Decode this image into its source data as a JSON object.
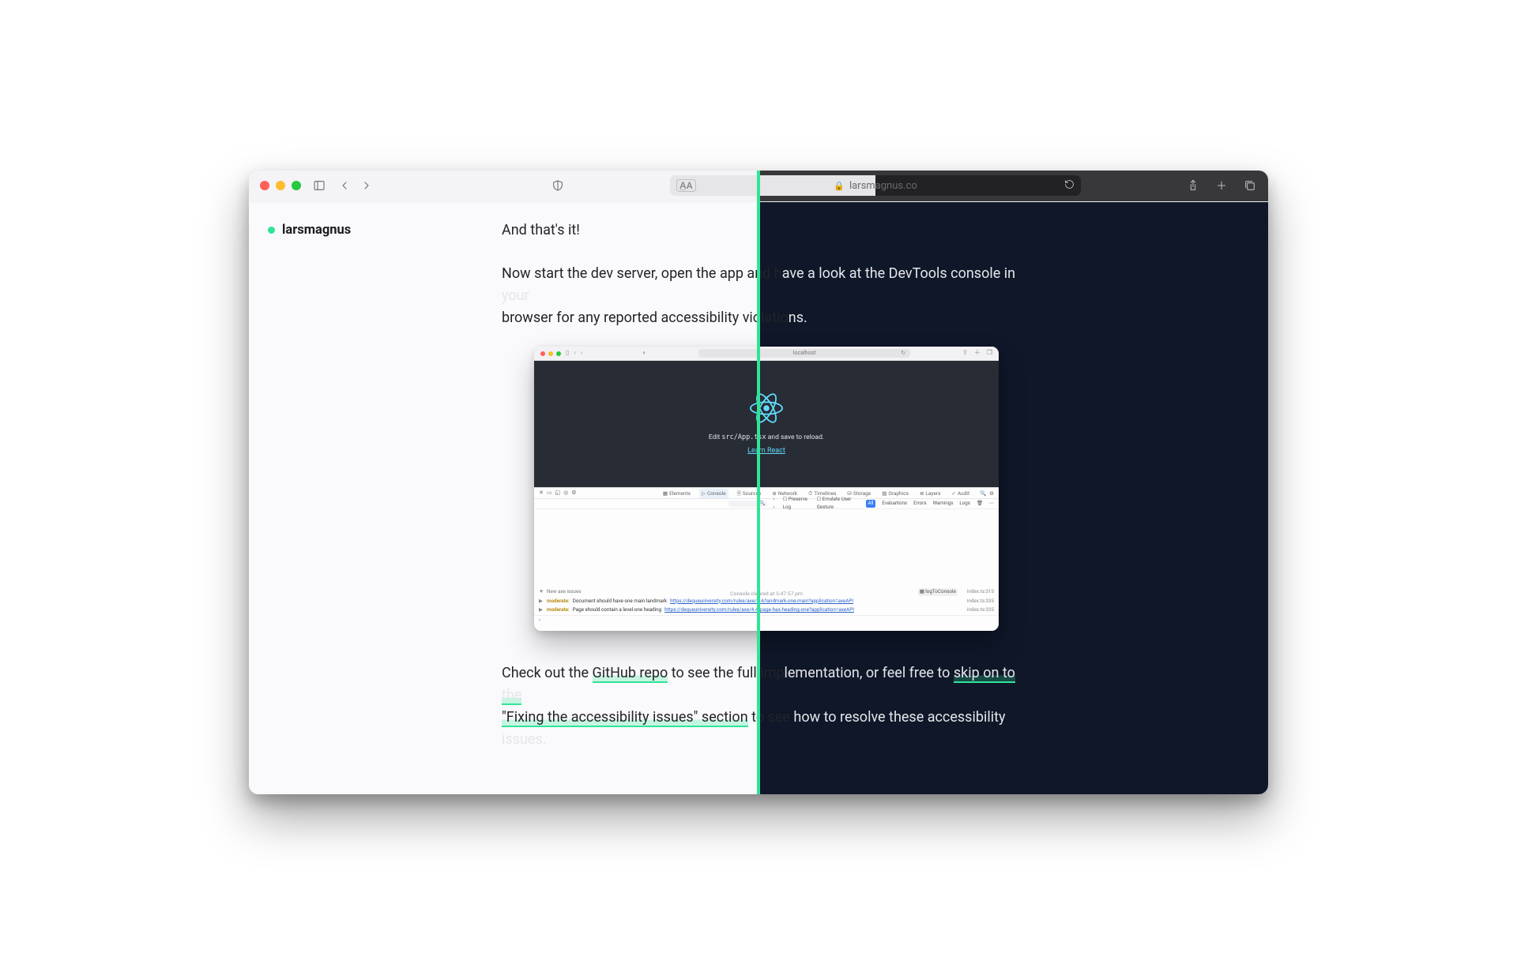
{
  "browser": {
    "address": "larsmagnus.co",
    "icons": {
      "close": "close-traffic-light",
      "minimize": "minimize-traffic-light",
      "maximize": "maximize-traffic-light",
      "sidebar": "sidebar-icon",
      "back": "chevron-left-icon",
      "forward": "chevron-right-icon",
      "shield": "shield-icon",
      "textsize": "textsize-icon",
      "lock": "lock-icon",
      "refresh": "refresh-icon",
      "share": "share-icon",
      "newtab": "plus-icon",
      "tabs": "tabs-icon"
    }
  },
  "site": {
    "brand": "larsmagnus"
  },
  "article": {
    "p1": "And that's it!",
    "p2_light": "Now start the dev server, open the app and h",
    "p2_dark": "ave a look at the DevTools console in your",
    "p2b_light": "browser for any reported accessibility violatio",
    "p2b_dark": "ns.",
    "p3_light_a": "Check out the ",
    "p3_link1": "GitHub repo",
    "p3_light_b": " to see the full imp",
    "p3_dark_a": "lementation, or feel free to ",
    "p3_link2_dark": "skip on to the",
    "p3_link2_light": "\"Fixing the accessibility issues\" section",
    "p3_light_c": " to see",
    "p3_dark_b": " how to resolve these accessibility issues."
  },
  "shot": {
    "address": "localhost",
    "app": {
      "edit_pre": "Edit ",
      "edit_code": "src/App.tsx",
      "edit_post": " and save to reload.",
      "learn": "Learn React"
    },
    "devtools": {
      "tabs": [
        "Elements",
        "Console",
        "Sources",
        "Network",
        "Timelines",
        "Storage",
        "Graphics",
        "Layers",
        "Audit"
      ],
      "active_tab": "Console",
      "filter": {
        "preserve": "Preserve Log",
        "emulate": "Emulate User Gesture",
        "all": "All",
        "groups": [
          "Evaluations",
          "Errors",
          "Warnings",
          "Logs"
        ]
      },
      "cleared": "Console cleared at 5:47:57 pm",
      "group_header": "New axe issues",
      "log_to_console": "logToConsole",
      "src_header": "index.ts:315",
      "lines": [
        {
          "severity": "moderate:",
          "msg": "Document should have one main landmark",
          "link": "https://dequeuniversity.com/rules/axe/4.4/landmark-one-main?application=axeAPI",
          "src": "index.ts:335"
        },
        {
          "severity": "moderate:",
          "msg": "Page should contain a level-one heading",
          "link": "https://dequeuniversity.com/rules/axe/4.4/page-has-heading-one?application=axeAPI",
          "src": "index.ts:335"
        }
      ]
    }
  }
}
